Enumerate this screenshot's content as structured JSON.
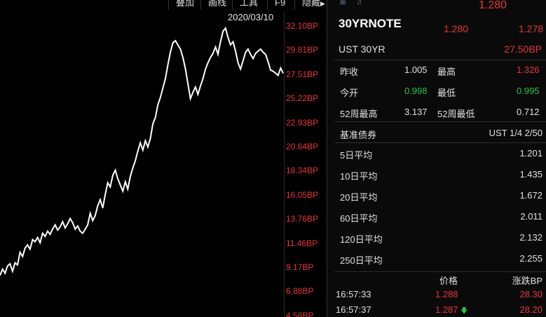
{
  "toolbar": {
    "items": [
      "叠加",
      "画线",
      "工具",
      "F9",
      "隐藏"
    ],
    "date": "2020/03/10"
  },
  "chart": {
    "y_ticks": [
      "32.10BP",
      "29.81BP",
      "27.51BP",
      "25.22BP",
      "22.93BP",
      "20.64BP",
      "18.34BP",
      "16.05BP",
      "13.76BP",
      "11.46BP",
      "9.17BP",
      "6.88BP",
      "4.58BP"
    ],
    "line_color": "#ffffff",
    "tick_color": "#e0393a"
  },
  "chart_data": {
    "type": "line",
    "title": "",
    "xlabel": "",
    "ylabel": "",
    "ylim": [
      4.58,
      32.1
    ],
    "series": [
      {
        "values": [
          8.4,
          9.0,
          8.6,
          9.3,
          9.5,
          8.8,
          9.6,
          9.4,
          10.6,
          10.2,
          11.0,
          11.3,
          10.9,
          11.8,
          11.6,
          12.0,
          11.5,
          12.4,
          12.1,
          12.6,
          12.3,
          12.8,
          13.2,
          12.7,
          13.0,
          13.5,
          12.9,
          13.3,
          13.8,
          13.4,
          12.8,
          13.1,
          12.6,
          12.4,
          12.8,
          13.2,
          14.3,
          13.6,
          14.1,
          15.0,
          15.6,
          14.8,
          16.1,
          17.2,
          16.8,
          17.9,
          18.4,
          17.6,
          17.0,
          16.4,
          17.3,
          16.6,
          17.8,
          18.6,
          19.3,
          20.2,
          21.0,
          20.3,
          21.2,
          20.6,
          21.4,
          22.8,
          23.4,
          24.6,
          25.3,
          26.2,
          27.1,
          28.4,
          29.6,
          30.5,
          30.7,
          30.3,
          29.9,
          29.1,
          28.0,
          26.6,
          25.2,
          25.8,
          26.3,
          25.6,
          26.4,
          27.1,
          28.0,
          28.6,
          29.1,
          29.5,
          30.1,
          29.4,
          30.6,
          31.6,
          31.9,
          31.0,
          30.3,
          30.6,
          29.7,
          28.6,
          28.0,
          28.8,
          29.6,
          29.9,
          29.4,
          29.0,
          29.5,
          29.7,
          29.9,
          29.6,
          29.4,
          28.7,
          27.9,
          27.8,
          27.6,
          27.4,
          28.1,
          27.6
        ]
      }
    ]
  },
  "quote": {
    "top_price": "1.280",
    "symbol": "30YRNOTE",
    "bid": "1.280",
    "ask": "1.278",
    "name": "UST 30YR",
    "change_bp": "27.50BP",
    "prev_close_label": "昨收",
    "prev_close": "1.005",
    "high_label": "最高",
    "high": "1.326",
    "open_label": "今开",
    "open": "0.998",
    "low_label": "最低",
    "low": "0.995",
    "wk52_high_label": "52周最高",
    "wk52_high": "3.137",
    "wk52_low_label": "52周最低",
    "wk52_low": "0.712",
    "benchmark_label": "基准债券",
    "benchmark": "UST 1/4 2/50",
    "ma": [
      {
        "label": "5日平均",
        "value": "1.201"
      },
      {
        "label": "10日平均",
        "value": "1.435"
      },
      {
        "label": "20日平均",
        "value": "1.672"
      },
      {
        "label": "60日平均",
        "value": "2.011"
      },
      {
        "label": "120日平均",
        "value": "2.132"
      },
      {
        "label": "250日平均",
        "value": "2.255"
      }
    ],
    "trades_header": {
      "price": "价格",
      "change": "涨跌BP"
    },
    "trades": [
      {
        "time": "16:57:33",
        "price": "1.288",
        "arrow": "",
        "change": "28.30"
      },
      {
        "time": "16:57:37",
        "price": "1.287",
        "arrow": "🡇",
        "change": "28.20"
      }
    ]
  }
}
